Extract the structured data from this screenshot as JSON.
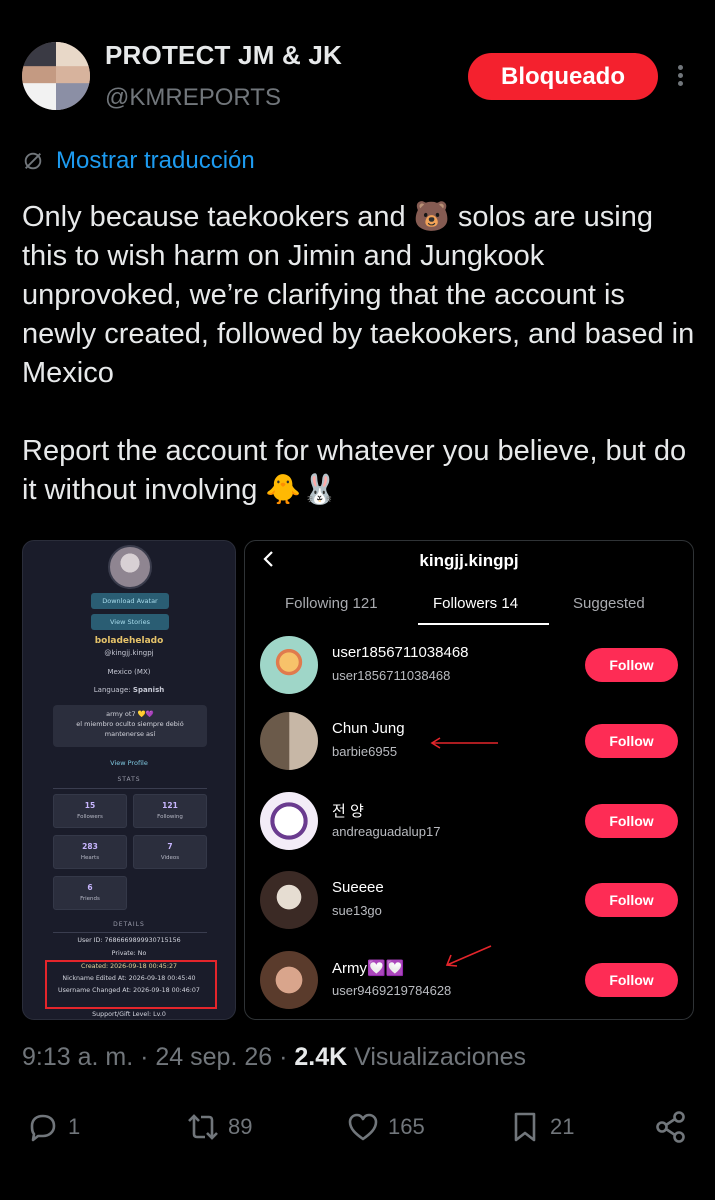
{
  "author": {
    "name": "PROTECT JM & JK",
    "handle": "@KMREPORTS",
    "avatar_icon": "two-person-avatar"
  },
  "header": {
    "blocked_label": "Bloqueado",
    "more_icon": "vertical-dots-icon"
  },
  "translate": {
    "label": "Mostrar traducción",
    "icon": "globe-slash-icon"
  },
  "tweet": {
    "paragraph1": "Only because taekookers and 🐻 solos are using this to wish harm on Jimin and Jungkook unprovoked, we’re clarifying that the account is newly created, followed by taekookers, and based in Mexico",
    "paragraph2": "Report the account for whatever you believe, but do it without involving 🐥🐰"
  },
  "left_image": {
    "download_avatar": "Download Avatar",
    "view_stories": "View Stories",
    "display_name": "boladehelado",
    "username": "@kingjj.kingpj",
    "location": "Mexico (MX)",
    "language_label": "Language:",
    "language_value": "Spanish",
    "bio_line1": "army ot7 💛💜",
    "bio_line2": "el miembro oculto siempre debió",
    "bio_line3": "mantenerse así",
    "view_profile": "View Profile",
    "stats_heading": "STATS",
    "stats": [
      {
        "value": "15",
        "label": "Followers"
      },
      {
        "value": "121",
        "label": "Following"
      },
      {
        "value": "283",
        "label": "Hearts"
      },
      {
        "value": "7",
        "label": "Videos"
      },
      {
        "value": "6",
        "label": "Friends"
      }
    ],
    "details_heading": "DETAILS",
    "user_id": "User ID:  7686669899930715156",
    "private": "Private:  No",
    "created": "Created:  2026-09-18 00:45:27",
    "nickname_edited": "Nickname Edited At:  2026-09-18 00:45:40",
    "username_changed_label": "Username Changed At:",
    "username_changed_value": "2026-09-18 00:46:07",
    "support_level": "Support/Gift Level:  Lv.0"
  },
  "right_image": {
    "title": "kingjj.kingpj",
    "tabs": [
      "Following 121",
      "Followers 14",
      "Suggested"
    ],
    "active_tab": 1,
    "follow_label": "Follow",
    "accent": "#fe2c55",
    "users": [
      {
        "name": "user1856711038468",
        "id": "user1856711038468",
        "arrow": false
      },
      {
        "name": "Chun Jung",
        "id": "barbie6955",
        "arrow": true
      },
      {
        "name": "전 양",
        "id": "andreaguadalup17",
        "arrow": false
      },
      {
        "name": "Sueeee",
        "id": "sue13go",
        "arrow": false
      },
      {
        "name": "Army💟💟",
        "id": "user9469219784628",
        "arrow": true
      }
    ]
  },
  "meta": {
    "time": "9:13 a. m.",
    "date": "24 sep. 26",
    "views": "2.4K",
    "views_label": "Visualizaciones"
  },
  "actions": {
    "replies": "1",
    "reposts": "89",
    "likes": "165",
    "bookmarks": "21"
  }
}
